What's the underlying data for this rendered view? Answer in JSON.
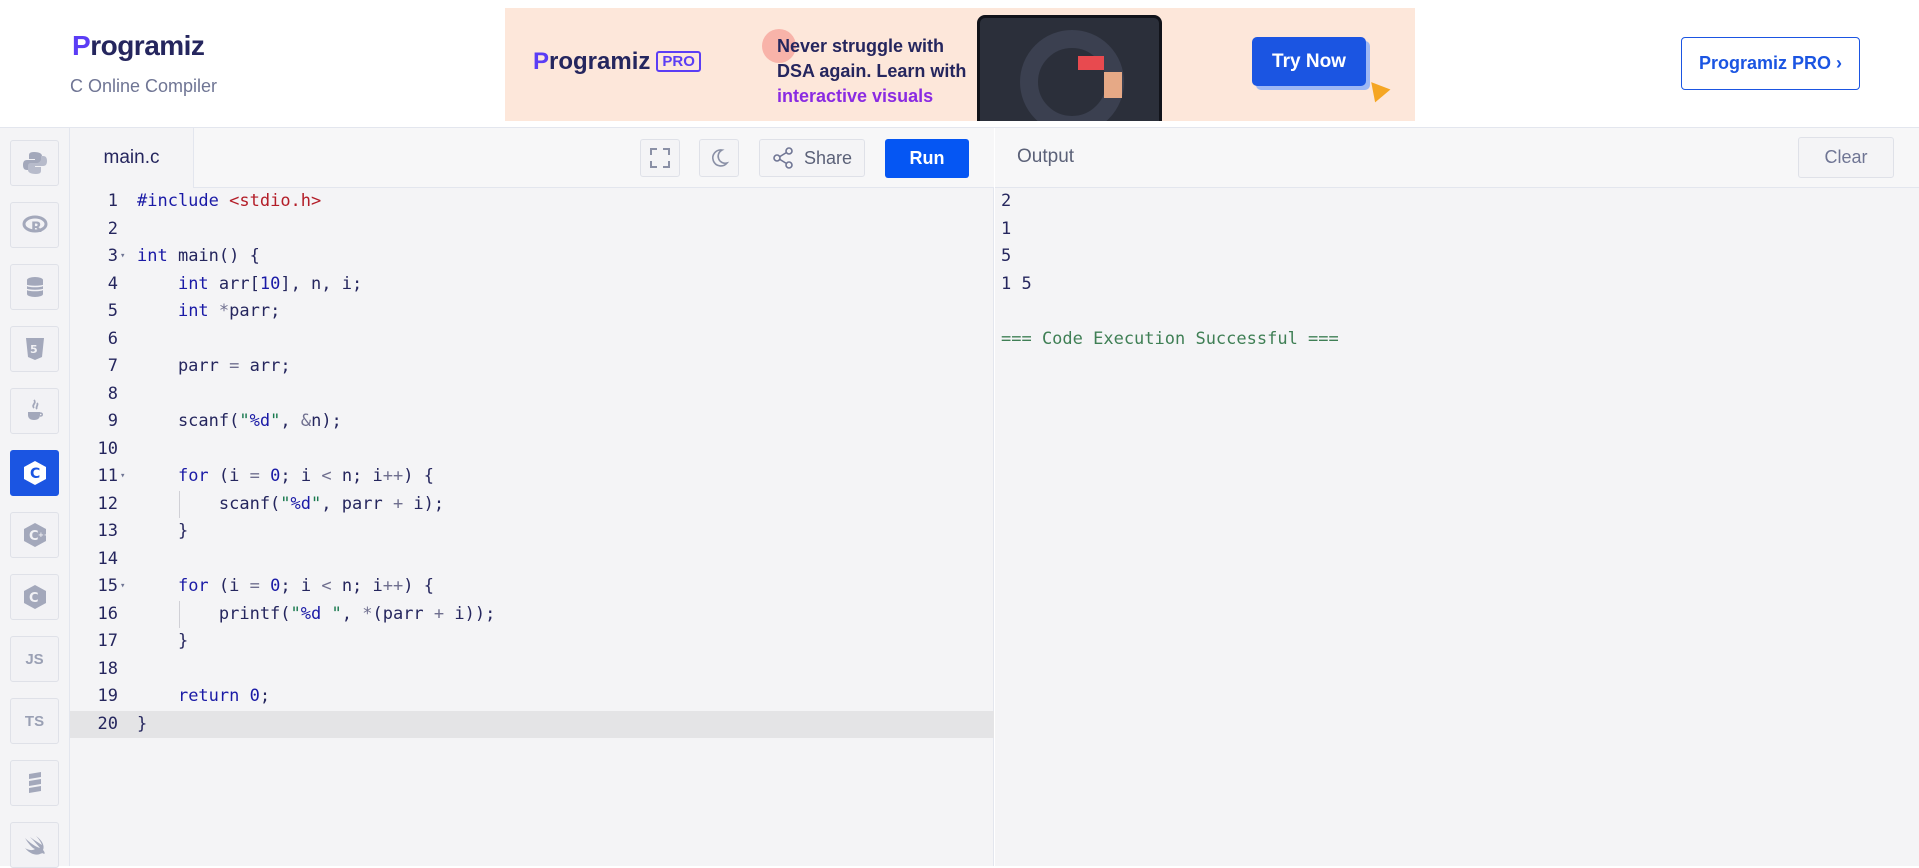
{
  "header": {
    "logo_text": "rogramiz",
    "logo_initial": "P",
    "subtitle": "C Online Compiler",
    "pro_button": "Programiz PRO ›"
  },
  "ad": {
    "logo_initial": "P",
    "logo_text": "rogramiz",
    "logo_badge": "PRO",
    "line1": "Never struggle with",
    "line2": "DSA again. Learn with",
    "line3": "interactive visuals",
    "cta": "Try Now"
  },
  "languages": [
    {
      "name": "python",
      "label": "",
      "active": false
    },
    {
      "name": "r",
      "label": "",
      "active": false
    },
    {
      "name": "sql",
      "label": "",
      "active": false
    },
    {
      "name": "html",
      "label": "",
      "active": false
    },
    {
      "name": "java",
      "label": "",
      "active": false
    },
    {
      "name": "c",
      "label": "",
      "active": true
    },
    {
      "name": "cpp",
      "label": "",
      "active": false
    },
    {
      "name": "csharp",
      "label": "",
      "active": false
    },
    {
      "name": "javascript",
      "label": "JS",
      "active": false
    },
    {
      "name": "typescript",
      "label": "TS",
      "active": false
    },
    {
      "name": "scala",
      "label": "",
      "active": false
    },
    {
      "name": "swift",
      "label": "",
      "active": false
    }
  ],
  "editor": {
    "file_name": "main.c",
    "share_label": "Share",
    "run_label": "Run",
    "current_line": 20,
    "lines": [
      "#include <stdio.h>",
      "",
      "int main() {",
      "    int arr[10], n, i;",
      "    int *parr;",
      "",
      "    parr = arr;",
      "",
      "    scanf(\"%d\", &n);",
      "",
      "    for (i = 0; i < n; i++) {",
      "        scanf(\"%d\", parr + i);",
      "    }",
      "",
      "    for (i = 0; i < n; i++) {",
      "        printf(\"%d \", *(parr + i));",
      "    }",
      "",
      "    return 0;",
      "}"
    ]
  },
  "output": {
    "title": "Output",
    "clear_label": "Clear",
    "lines": [
      "2",
      "1",
      "5",
      "1 5",
      ""
    ],
    "status": "=== Code Execution Successful ==="
  }
}
